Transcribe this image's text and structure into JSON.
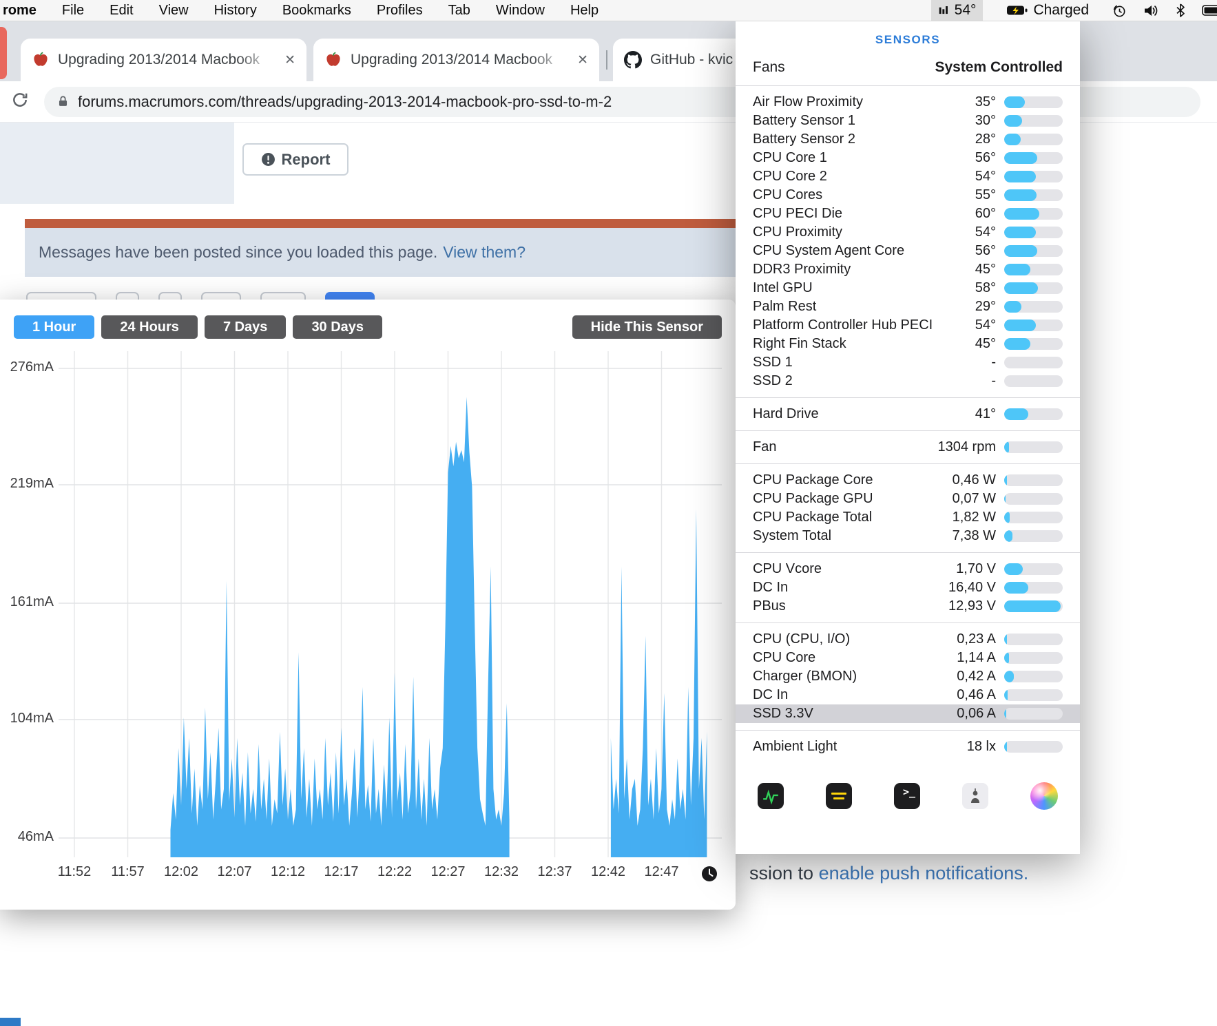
{
  "menubar": {
    "app_name": "rome",
    "menus": [
      "File",
      "Edit",
      "View",
      "History",
      "Bookmarks",
      "Profiles",
      "Tab",
      "Window",
      "Help"
    ],
    "temperature": "54°",
    "battery_label": "Charged"
  },
  "browser": {
    "tabs": [
      {
        "title": "Upgrading 2013/2014 Macbook",
        "icon": "macrumors"
      },
      {
        "title": "Upgrading 2013/2014 Macbook",
        "icon": "macrumors"
      },
      {
        "title": "GitHub - kvic",
        "icon": "github"
      }
    ],
    "url": "forums.macrumors.com/threads/upgrading-2013-2014-macbook-pro-ssd-to-m-2"
  },
  "page": {
    "report_label": "Report",
    "notice_text": "Messages have been posted since you loaded this page.",
    "notice_link": "View them?",
    "push_fragment": "ssion to ",
    "push_link": "enable push notifications."
  },
  "chart_window": {
    "range_buttons": [
      {
        "label": "1 Hour",
        "active": true
      },
      {
        "label": "24 Hours",
        "active": false
      },
      {
        "label": "7 Days",
        "active": false
      },
      {
        "label": "30 Days",
        "active": false
      }
    ],
    "hide_button": "Hide This Sensor"
  },
  "chart_data": {
    "type": "area",
    "unit": "mA",
    "y_ticks": [
      276,
      219,
      161,
      104,
      46
    ],
    "ylim": [
      36,
      285
    ],
    "x_tick_labels": [
      "11:52",
      "11:57",
      "12:02",
      "12:07",
      "12:12",
      "12:17",
      "12:22",
      "12:27",
      "12:32",
      "12:37",
      "12:42",
      "12:47"
    ],
    "x_tick_minutes": [
      2,
      7,
      12,
      17,
      22,
      27,
      32,
      37,
      42,
      47,
      52,
      57
    ],
    "time_origin": "11:50",
    "segments": [
      {
        "t0": 11.0,
        "dt": 0.25,
        "values": [
          50,
          68,
          55,
          90,
          62,
          105,
          70,
          95,
          58,
          80,
          52,
          72,
          60,
          110,
          65,
          88,
          55,
          75,
          100,
          60,
          70,
          172,
          64,
          85,
          56,
          95,
          62,
          78,
          52,
          88,
          58,
          70,
          54,
          92,
          60,
          75,
          55,
          85,
          52,
          65,
          58,
          98,
          62,
          80,
          55,
          70,
          52,
          60,
          137,
          65,
          90,
          56,
          75,
          52,
          85,
          60,
          70,
          55,
          95,
          62,
          78,
          54,
          88,
          58,
          100,
          62,
          75,
          52,
          68,
          90,
          56,
          80,
          120,
          60,
          72,
          54,
          95,
          58,
          70,
          52,
          82,
          60,
          105,
          56,
          127,
          64,
          78,
          55,
          92,
          58,
          70,
          125,
          60,
          85,
          55,
          75,
          52,
          95,
          60,
          70,
          55,
          80,
          90,
          150,
          225,
          238,
          228,
          240,
          232,
          236,
          230,
          262,
          235,
          218,
          150,
          90,
          65,
          58,
          52,
          120,
          179,
          70,
          55,
          60,
          52,
          68,
          112,
          55
        ]
      },
      {
        "t0": 52.25,
        "dt": 0.25,
        "values": [
          95,
          60,
          75,
          58,
          179,
          65,
          85,
          55,
          70,
          75,
          52,
          60,
          90,
          145,
          62,
          75,
          55,
          90,
          58,
          70,
          117,
          60,
          52,
          65,
          55,
          85,
          60,
          70,
          55,
          120,
          62,
          95,
          207,
          70,
          95,
          55,
          98
        ]
      }
    ]
  },
  "sensors": {
    "header": "SENSORS",
    "fans_label": "Fans",
    "fans_value": "System Controlled",
    "groups": [
      {
        "rows": [
          {
            "label": "Air Flow Proximity",
            "value": "35°",
            "bar": 0.35
          },
          {
            "label": "Battery Sensor 1",
            "value": "30°",
            "bar": 0.3
          },
          {
            "label": "Battery Sensor 2",
            "value": "28°",
            "bar": 0.28
          },
          {
            "label": "CPU Core 1",
            "value": "56°",
            "bar": 0.56
          },
          {
            "label": "CPU Core 2",
            "value": "54°",
            "bar": 0.54
          },
          {
            "label": "CPU Cores",
            "value": "55°",
            "bar": 0.55
          },
          {
            "label": "CPU PECI Die",
            "value": "60°",
            "bar": 0.6
          },
          {
            "label": "CPU Proximity",
            "value": "54°",
            "bar": 0.54
          },
          {
            "label": "CPU System Agent Core",
            "value": "56°",
            "bar": 0.56
          },
          {
            "label": "DDR3 Proximity",
            "value": "45°",
            "bar": 0.45
          },
          {
            "label": "Intel GPU",
            "value": "58°",
            "bar": 0.58
          },
          {
            "label": "Palm Rest",
            "value": "29°",
            "bar": 0.29
          },
          {
            "label": "Platform Controller Hub PECI",
            "value": "54°",
            "bar": 0.54
          },
          {
            "label": "Right Fin Stack",
            "value": "45°",
            "bar": 0.45
          },
          {
            "label": "SSD 1",
            "value": "-",
            "bar": 0
          },
          {
            "label": "SSD 2",
            "value": "-",
            "bar": 0
          }
        ]
      },
      {
        "rows": [
          {
            "label": "Hard Drive",
            "value": "41°",
            "bar": 0.41
          }
        ]
      },
      {
        "rows": [
          {
            "label": "Fan",
            "value": "1304 rpm",
            "bar": 0.08
          }
        ]
      },
      {
        "rows": [
          {
            "label": "CPU Package Core",
            "value": "0,46 W",
            "bar": 0.05
          },
          {
            "label": "CPU Package GPU",
            "value": "0,07 W",
            "bar": 0.02
          },
          {
            "label": "CPU Package Total",
            "value": "1,82 W",
            "bar": 0.09
          },
          {
            "label": "System Total",
            "value": "7,38 W",
            "bar": 0.14
          }
        ]
      },
      {
        "rows": [
          {
            "label": "CPU Vcore",
            "value": "1,70 V",
            "bar": 0.32
          },
          {
            "label": "DC In",
            "value": "16,40 V",
            "bar": 0.41
          },
          {
            "label": "PBus",
            "value": "12,93 V",
            "bar": 0.97
          }
        ]
      },
      {
        "rows": [
          {
            "label": "CPU (CPU, I/O)",
            "value": "0,23 A",
            "bar": 0.05
          },
          {
            "label": "CPU Core",
            "value": "1,14 A",
            "bar": 0.08
          },
          {
            "label": "Charger (BMON)",
            "value": "0,42 A",
            "bar": 0.16
          },
          {
            "label": "DC In",
            "value": "0,46 A",
            "bar": 0.06
          },
          {
            "label": "SSD 3.3V",
            "value": "0,06 A",
            "bar": 0.04,
            "selected": true
          }
        ]
      },
      {
        "rows": [
          {
            "label": "Ambient Light",
            "value": "18 lx",
            "bar": 0.05
          }
        ]
      }
    ],
    "dock_icons": [
      "istat-activity-icon",
      "console-warning-icon",
      "terminal-icon",
      "robot-figure-icon",
      "color-sphere-icon"
    ]
  }
}
